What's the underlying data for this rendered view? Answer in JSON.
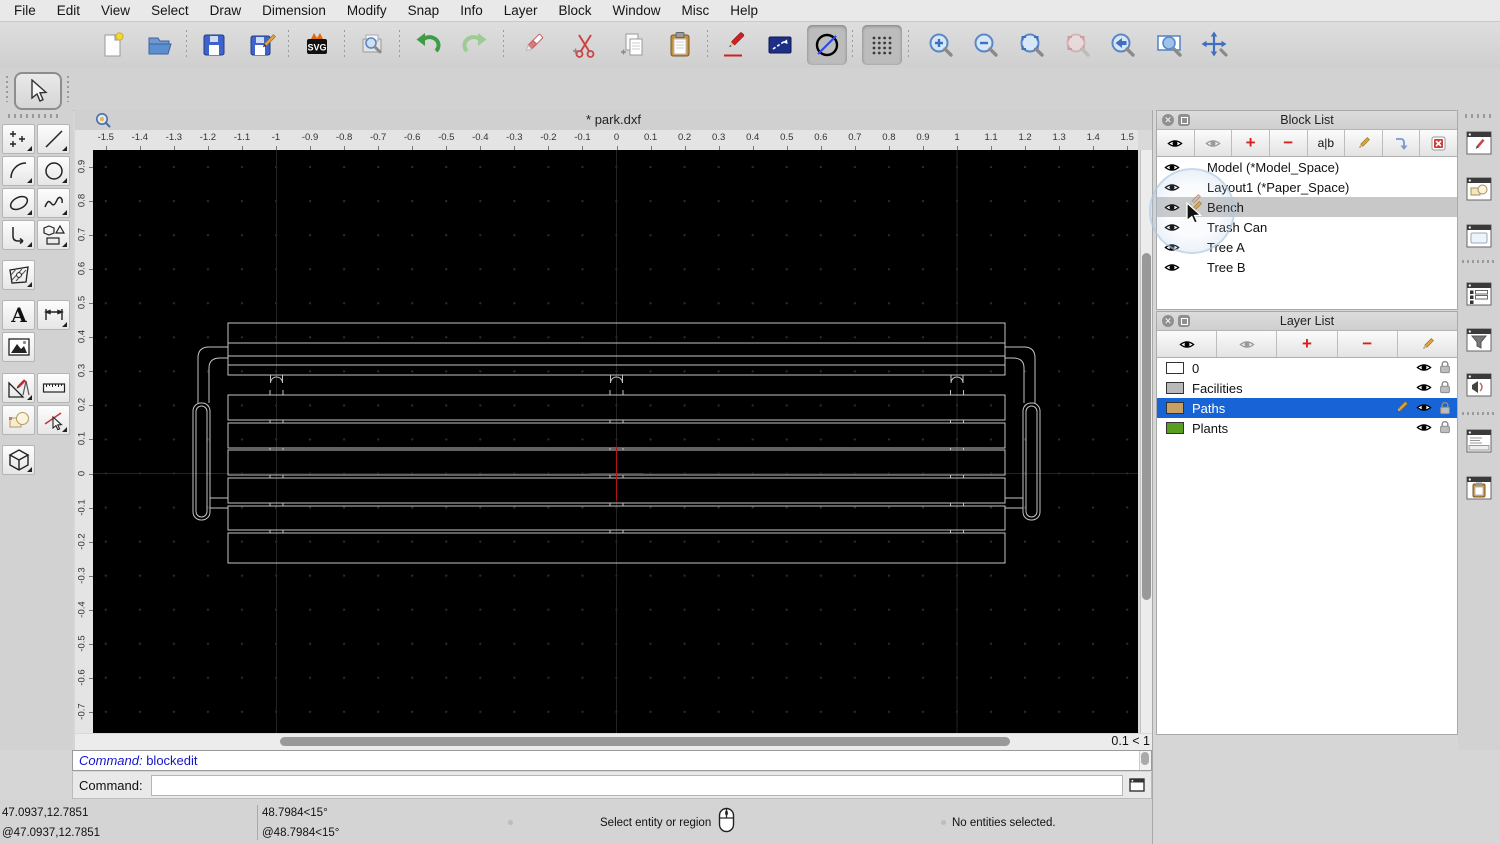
{
  "menu_bar": {
    "items": [
      "File",
      "Edit",
      "View",
      "Select",
      "Draw",
      "Dimension",
      "Modify",
      "Snap",
      "Info",
      "Layer",
      "Block",
      "Window",
      "Misc",
      "Help"
    ]
  },
  "toolbar": {
    "svg_label": "SVG",
    "icons": [
      "new-file",
      "open-file",
      "save",
      "save-as",
      "svg-export",
      "print-preview",
      "undo",
      "redo",
      "erase",
      "cut",
      "copy",
      "paste",
      "draft-pencil",
      "lineweight",
      "screen-linetypes",
      "grid-toggle",
      "zoom-in",
      "zoom-out",
      "zoom-auto",
      "zoom-selection",
      "zoom-previous",
      "zoom-window",
      "pan"
    ]
  },
  "tool_palette": {
    "tools": [
      "selection",
      "point",
      "line",
      "arc",
      "circle",
      "ellipse",
      "spline",
      "polyline",
      "shape",
      "hatch",
      "text",
      "dimension",
      "image",
      "modify",
      "measure",
      "block-edit",
      "select-entity",
      "isometric-view"
    ]
  },
  "document": {
    "title": "* park.dxf"
  },
  "rulers": {
    "horizontal": [
      "-1.5",
      "-1.4",
      "-1.3",
      "-1.2",
      "-1.1",
      "-1",
      "-0.9",
      "-0.8",
      "-0.7",
      "-0.6",
      "-0.5",
      "-0.4",
      "-0.3",
      "-0.2",
      "-0.1",
      "0",
      "0.1",
      "0.2",
      "0.3",
      "0.4",
      "0.5",
      "0.6",
      "0.7",
      "0.8",
      "0.9",
      "1",
      "1.1",
      "1.2",
      "1.3",
      "1.4",
      "1.5"
    ],
    "vertical": [
      "0.9",
      "0.8",
      "0.7",
      "0.6",
      "0.5",
      "0.4",
      "0.3",
      "0.2",
      "0.1",
      "0",
      "-0.1",
      "-0.2",
      "-0.3",
      "-0.4",
      "-0.5",
      "-0.6",
      "-0.7"
    ]
  },
  "canvas": {
    "grid_indicator": "0.1 < 1",
    "background": "#000000",
    "line_color": "#c4c4c4",
    "crosshair_color": "#b01515"
  },
  "block_list": {
    "title": "Block List",
    "rename_label": "a|b",
    "items": [
      "Model (*Model_Space)",
      "Layout1 (*Paper_Space)",
      "Bench",
      "Trash Can",
      "Tree A",
      "Tree B"
    ],
    "selected_index": 2
  },
  "layer_list": {
    "title": "Layer List",
    "layers": [
      {
        "name": "0",
        "color": "#ffffff",
        "selected": false
      },
      {
        "name": "Facilities",
        "color": "#b9b9b9",
        "selected": false
      },
      {
        "name": "Paths",
        "color": "#c9a063",
        "selected": true
      },
      {
        "name": "Plants",
        "color": "#5a9e1f",
        "selected": false
      }
    ]
  },
  "command_area": {
    "history_label": "Command:",
    "history_command": "blockedit",
    "prompt_label": "Command:",
    "input_value": ""
  },
  "status_bar": {
    "coord_abs": "47.0937,12.7851",
    "coord_rel": "@47.0937,12.7851",
    "polar_abs": "48.7984<15°",
    "polar_rel": "@48.7984<15°",
    "hint": "Select entity or region",
    "selection": "No entities selected."
  }
}
